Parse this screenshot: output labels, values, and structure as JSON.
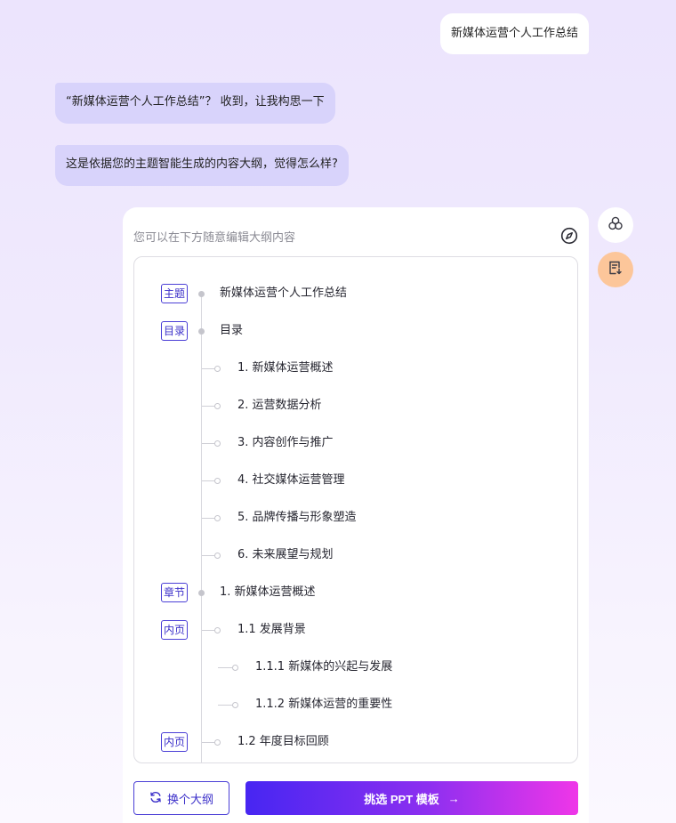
{
  "chat": {
    "user_message": "新媒体运营个人工作总结",
    "ai_message_1": "“新媒体运营个人工作总结”？ 收到，让我构思一下",
    "ai_message_2": "这是依据您的主题智能生成的内容大纲，觉得怎么样?"
  },
  "outline_card": {
    "hint": "您可以在下方随意编辑大纲内容",
    "items": [
      {
        "tag": "主题",
        "text": "新媒体运营个人工作总结",
        "level": 0
      },
      {
        "tag": "目录",
        "text": "目录",
        "level": 0
      },
      {
        "tag": "",
        "text": "1. 新媒体运营概述",
        "level": 1
      },
      {
        "tag": "",
        "text": "2. 运营数据分析",
        "level": 1
      },
      {
        "tag": "",
        "text": "3. 内容创作与推广",
        "level": 1
      },
      {
        "tag": "",
        "text": "4. 社交媒体运营管理",
        "level": 1
      },
      {
        "tag": "",
        "text": "5. 品牌传播与形象塑造",
        "level": 1
      },
      {
        "tag": "",
        "text": "6. 未来展望与规划",
        "level": 1
      },
      {
        "tag": "章节",
        "text": "1. 新媒体运营概述",
        "level": 0
      },
      {
        "tag": "内页",
        "text": "1.1 发展背景",
        "level": 1
      },
      {
        "tag": "",
        "text": "1.1.1 新媒体的兴起与发展",
        "level": 2
      },
      {
        "tag": "",
        "text": "1.1.2 新媒体运营的重要性",
        "level": 2
      },
      {
        "tag": "内页",
        "text": "1.2 年度目标回顾",
        "level": 1
      }
    ],
    "change_outline_label": "换个大纲",
    "choose_template_label": "挑选 PPT 模板",
    "choose_template_arrow": "→"
  },
  "icons": {
    "compass": "compass-icon",
    "refresh": "refresh-icon",
    "side_1": "circles-icon",
    "side_2": "document-download-icon"
  },
  "colors": {
    "accent": "#4b3fd6",
    "ai_bubble": "#d8d3fb",
    "gradient_start": "#4726f2",
    "gradient_end": "#ef36e8",
    "side_button_orange": "#fcc69a"
  }
}
